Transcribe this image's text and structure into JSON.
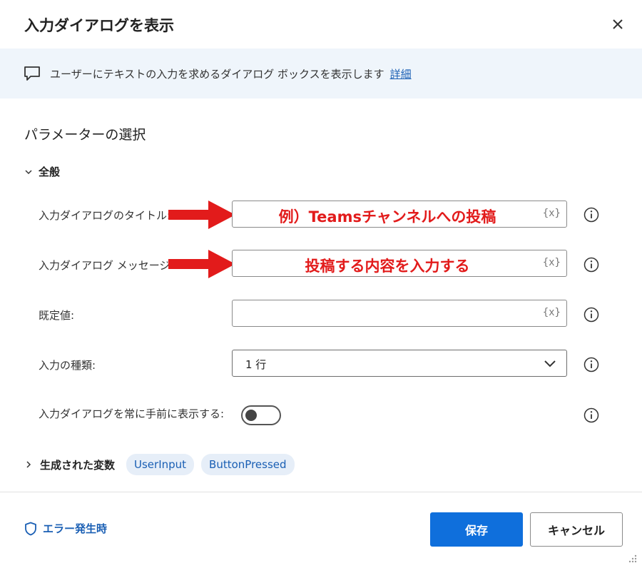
{
  "dialog": {
    "title": "入力ダイアログを表示",
    "description": "ユーザーにテキストの入力を求めるダイアログ ボックスを表示します",
    "details_link": "詳細",
    "section_title": "パラメーターの選択",
    "group_general": "全般"
  },
  "fields": {
    "title_label": "入力ダイアログのタイトル:",
    "title_value": "例）Teamsチャンネルへの投稿",
    "message_label": "入力ダイアログ メッセージ:",
    "message_value": "投稿する内容を入力する",
    "default_label": "既定値:",
    "default_value": "",
    "input_type_label": "入力の種類:",
    "input_type_value": "1 行",
    "topmost_label": "入力ダイアログを常に手前に表示する:",
    "topmost_enabled": false,
    "var_hint": "{x}"
  },
  "variables": {
    "title": "生成された変数",
    "items": [
      "UserInput",
      "ButtonPressed"
    ]
  },
  "footer": {
    "error_label": "エラー発生時",
    "save_label": "保存",
    "cancel_label": "キャンセル"
  },
  "colors": {
    "accent": "#0f6fdc",
    "annotation": "#e21b1b",
    "banner_bg": "#eff5fb",
    "chip_bg": "#e6eef8"
  }
}
